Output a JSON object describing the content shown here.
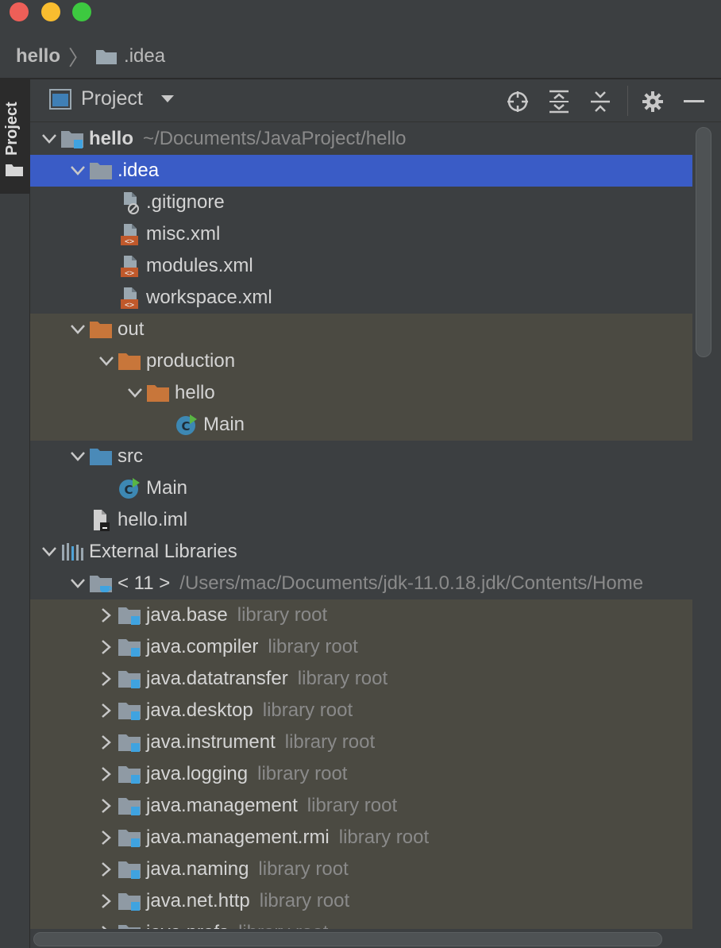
{
  "window": {
    "controls": [
      "close",
      "minimize",
      "zoom"
    ]
  },
  "breadcrumb": {
    "root": "hello",
    "folder": ".idea"
  },
  "toolstrip": {
    "label": "Project"
  },
  "panel": {
    "title": "Project",
    "tools": [
      "locate-icon",
      "expand-all-icon",
      "collapse-all-icon",
      "gear-icon",
      "hide-icon"
    ]
  },
  "colors": {
    "selection": "#3a5cc6",
    "excluded_bg": "#4b4a42",
    "folder_gray": "#8f9aa4",
    "folder_orange": "#c8763a",
    "folder_blue": "#4a8ab8",
    "module_blue": "#3fa3e0"
  },
  "tree": [
    {
      "depth": 0,
      "expanded": true,
      "icon": "module-folder-icon",
      "label": "hello",
      "hint": "~/Documents/JavaProject/hello",
      "bold": true
    },
    {
      "depth": 1,
      "expanded": true,
      "icon": "folder-gray-icon",
      "label": ".idea",
      "selected": true
    },
    {
      "depth": 2,
      "icon": "ignore-file-icon",
      "label": ".gitignore"
    },
    {
      "depth": 2,
      "icon": "xml-file-icon",
      "label": "misc.xml"
    },
    {
      "depth": 2,
      "icon": "xml-file-icon",
      "label": "modules.xml"
    },
    {
      "depth": 2,
      "icon": "xml-file-icon",
      "label": "workspace.xml"
    },
    {
      "depth": 1,
      "expanded": true,
      "icon": "folder-orange-icon",
      "label": "out",
      "excluded": true
    },
    {
      "depth": 2,
      "expanded": true,
      "icon": "folder-orange-icon",
      "label": "production",
      "excluded": true
    },
    {
      "depth": 3,
      "expanded": true,
      "icon": "folder-orange-icon",
      "label": "hello",
      "excluded": true
    },
    {
      "depth": 4,
      "icon": "class-icon",
      "label": "Main",
      "excluded": true
    },
    {
      "depth": 1,
      "expanded": true,
      "icon": "folder-blue-icon",
      "label": "src"
    },
    {
      "depth": 2,
      "icon": "class-icon",
      "label": "Main"
    },
    {
      "depth": 1,
      "icon": "iml-file-icon",
      "label": "hello.iml"
    },
    {
      "depth": 0,
      "expanded": true,
      "icon": "libraries-icon",
      "label": "External Libraries"
    },
    {
      "depth": 1,
      "expanded": true,
      "icon": "jdk-folder-icon",
      "label": "< 11 >",
      "hint": "/Users/mac/Documents/jdk-11.0.18.jdk/Contents/Home"
    },
    {
      "depth": 2,
      "expanded": false,
      "icon": "library-folder-icon",
      "label": "java.base",
      "hint": "library root",
      "excluded": true
    },
    {
      "depth": 2,
      "expanded": false,
      "icon": "library-folder-icon",
      "label": "java.compiler",
      "hint": "library root",
      "excluded": true
    },
    {
      "depth": 2,
      "expanded": false,
      "icon": "library-folder-icon",
      "label": "java.datatransfer",
      "hint": "library root",
      "excluded": true
    },
    {
      "depth": 2,
      "expanded": false,
      "icon": "library-folder-icon",
      "label": "java.desktop",
      "hint": "library root",
      "excluded": true
    },
    {
      "depth": 2,
      "expanded": false,
      "icon": "library-folder-icon",
      "label": "java.instrument",
      "hint": "library root",
      "excluded": true
    },
    {
      "depth": 2,
      "expanded": false,
      "icon": "library-folder-icon",
      "label": "java.logging",
      "hint": "library root",
      "excluded": true
    },
    {
      "depth": 2,
      "expanded": false,
      "icon": "library-folder-icon",
      "label": "java.management",
      "hint": "library root",
      "excluded": true
    },
    {
      "depth": 2,
      "expanded": false,
      "icon": "library-folder-icon",
      "label": "java.management.rmi",
      "hint": "library root",
      "excluded": true
    },
    {
      "depth": 2,
      "expanded": false,
      "icon": "library-folder-icon",
      "label": "java.naming",
      "hint": "library root",
      "excluded": true
    },
    {
      "depth": 2,
      "expanded": false,
      "icon": "library-folder-icon",
      "label": "java.net.http",
      "hint": "library root",
      "excluded": true
    },
    {
      "depth": 2,
      "expanded": false,
      "icon": "library-folder-icon",
      "label": "java.prefs",
      "hint": "library root",
      "excluded": true
    }
  ]
}
